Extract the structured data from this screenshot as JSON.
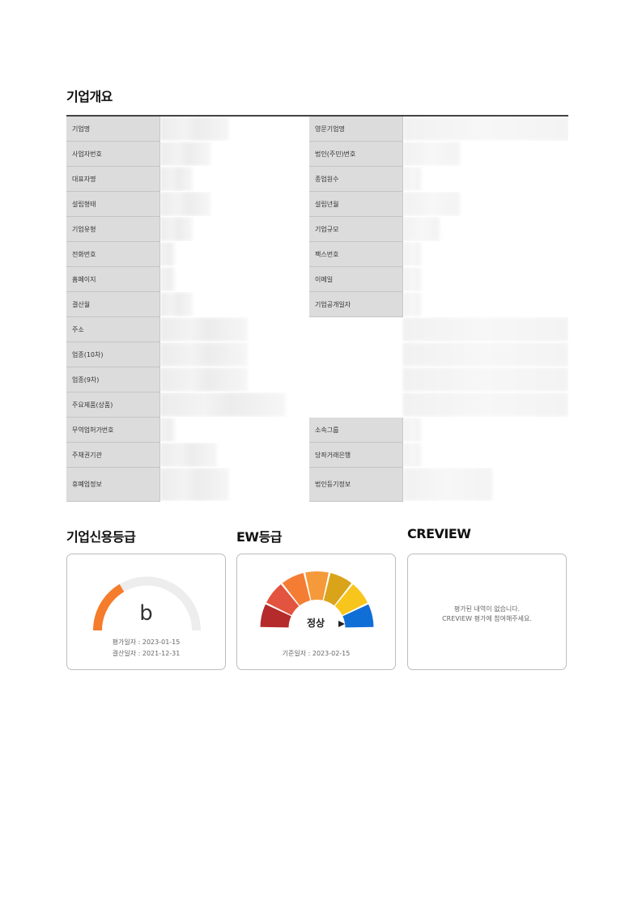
{
  "overview": {
    "title": "기업개요",
    "rows": [
      {
        "l1": "기업명",
        "l2": "영문기업명"
      },
      {
        "l1": "사업자번호",
        "l2": "법인(주민)번호"
      },
      {
        "l1": "대표자명",
        "l2": "종업원수"
      },
      {
        "l1": "설립형태",
        "l2": "설립년월"
      },
      {
        "l1": "기업유형",
        "l2": "기업규모"
      },
      {
        "l1": "전화번호",
        "l2": "팩스번호"
      },
      {
        "l1": "홈페이지",
        "l2": "이메일"
      },
      {
        "l1": "결산월",
        "l2": "기업공개일자"
      },
      {
        "l1": "주소"
      },
      {
        "l1": "업종(10차)"
      },
      {
        "l1": "업종(9차)"
      },
      {
        "l1": "주요제품(상품)"
      },
      {
        "l1": "무역업허가번호",
        "l2": "소속그룹"
      },
      {
        "l1": "주채권기관",
        "l2": "당좌거래은행"
      },
      {
        "l1": "휴폐업정보",
        "l2": "법인등기정보"
      }
    ]
  },
  "credit": {
    "title": "기업신용등급",
    "grade": "b",
    "gauge_fraction": 0.33,
    "eval_date": "평가일자 : 2023-01-15",
    "settle_date": "결산일자 : 2021-12-31",
    "colors": {
      "fill": "#f57c2b",
      "track": "#ededed"
    }
  },
  "ew": {
    "title": "EW등급",
    "status": "정상",
    "base_date": "기준일자 : 2023-02-15",
    "segment_colors": [
      "#b52a2a",
      "#e2543f",
      "#f47d33",
      "#f59a3a",
      "#d9a41a",
      "#f8c51c",
      "#0f6fd6"
    ],
    "indicator_icon": "pointer-triangle-icon"
  },
  "creview": {
    "title": "CREVIEW",
    "message_line1": "평가된 내역이 없습니다.",
    "message_line2": "CREVIEW 평가에 참여해주세요."
  }
}
